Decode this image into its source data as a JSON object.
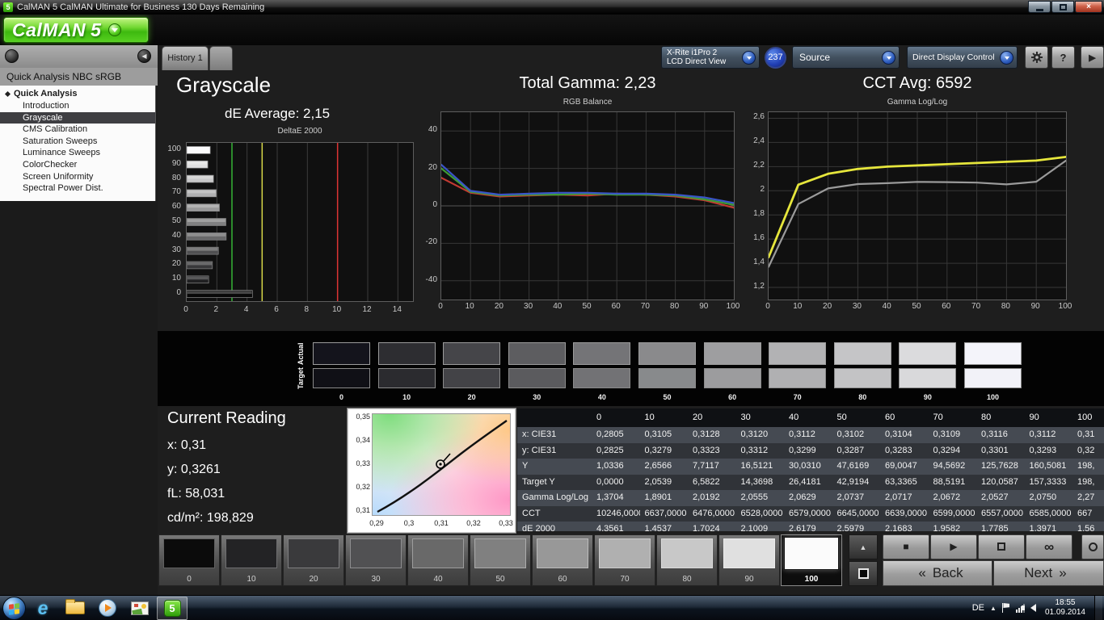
{
  "titlebar": {
    "app_icon": "5",
    "title": "CalMAN 5 CalMAN Ultimate for Business 130 Days Remaining",
    "close_glyph": "×"
  },
  "logo": {
    "brand": "CalMAN",
    "version": "5"
  },
  "toolbar": {
    "history_tab": "History 1",
    "meter": {
      "line1": "X-Rite i1Pro 2",
      "line2": "LCD Direct View"
    },
    "meter_count": "237",
    "source_label": "Source",
    "display_control_label": "Direct Display Control",
    "help_glyph": "?",
    "expand_glyph": "▶"
  },
  "sidebar": {
    "collapse_glyph": "◀",
    "workflow_title": "Quick Analysis NBC sRGB",
    "tree_root": "Quick Analysis",
    "selected_item": "Grayscale",
    "items": [
      "Introduction",
      "Grayscale",
      "CMS Calibration",
      "Saturation Sweeps",
      "Luminance Sweeps",
      "ColorChecker",
      "Screen Uniformity",
      "Spectral Power Dist."
    ]
  },
  "summary": {
    "page_title": "Grayscale",
    "de_average": "dE Average: 2,15",
    "total_gamma": "Total Gamma: 2,23",
    "cct_avg": "CCT Avg: 6592"
  },
  "chart_data": [
    {
      "type": "bar",
      "orientation": "horizontal",
      "title": "DeltaE 2000",
      "categories": [
        0,
        10,
        20,
        30,
        40,
        50,
        60,
        70,
        80,
        90,
        100
      ],
      "values": [
        4.3561,
        1.4537,
        1.7024,
        2.1009,
        2.6179,
        2.5979,
        2.1683,
        1.9582,
        1.7785,
        1.3971,
        1.56
      ],
      "bar_colors": [
        "#080808",
        "#202022",
        "#38383a",
        "#505052",
        "#686869",
        "#808081",
        "#989899",
        "#b0b0b1",
        "#c8c8c9",
        "#e0e0e1",
        "#fafafb"
      ],
      "xlim": [
        0,
        15
      ],
      "x_ticks": [
        0,
        2,
        4,
        6,
        8,
        10,
        12,
        14
      ],
      "reference_lines": [
        {
          "name": "good",
          "value": 3,
          "color": "#35b435"
        },
        {
          "name": "warn",
          "value": 5,
          "color": "#d8d848"
        },
        {
          "name": "fail",
          "value": 10,
          "color": "#dd3333"
        }
      ],
      "grid": true
    },
    {
      "type": "line",
      "title": "RGB Balance",
      "x": [
        0,
        10,
        20,
        30,
        40,
        50,
        60,
        70,
        80,
        90,
        100
      ],
      "x_ticks": [
        0,
        10,
        20,
        30,
        40,
        50,
        60,
        70,
        80,
        90,
        100
      ],
      "ylim": [
        -50,
        50
      ],
      "y_ticks": [
        40,
        20,
        0,
        -20,
        -40
      ],
      "series": [
        {
          "name": "Red",
          "color": "#c23a32",
          "width": 2.2,
          "values": [
            15,
            7,
            5,
            5.5,
            6,
            5.5,
            6.5,
            6,
            5,
            3,
            -1
          ]
        },
        {
          "name": "Green",
          "color": "#3f9c35",
          "width": 2.2,
          "values": [
            20,
            7.5,
            5.5,
            6,
            6,
            6.5,
            6,
            6,
            5.5,
            3.5,
            0.5
          ]
        },
        {
          "name": "Blue",
          "color": "#3a55c8",
          "width": 2.2,
          "values": [
            22,
            8,
            6,
            6.5,
            7,
            7,
            6.5,
            6.5,
            6,
            4.5,
            1.5
          ]
        }
      ],
      "grid": true
    },
    {
      "type": "line",
      "title": "Gamma Log/Log",
      "x": [
        0,
        10,
        20,
        30,
        40,
        50,
        60,
        70,
        80,
        90,
        100
      ],
      "x_ticks": [
        0,
        10,
        20,
        30,
        40,
        50,
        60,
        70,
        80,
        90,
        100
      ],
      "ylim": [
        1.1,
        2.65
      ],
      "y_ticks": [
        2.6,
        2.4,
        2.2,
        2,
        1.8,
        1.6,
        1.4,
        1.2
      ],
      "y_tick_labels": [
        "2,6",
        "2,4",
        "2,2",
        "2",
        "1,8",
        "1,6",
        "1,4",
        "1,2"
      ],
      "series": [
        {
          "name": "Target",
          "color": "#e6e63c",
          "width": 2.8,
          "values": [
            1.45,
            2.05,
            2.14,
            2.18,
            2.2,
            2.21,
            2.22,
            2.23,
            2.24,
            2.25,
            2.28
          ]
        },
        {
          "name": "Measured",
          "color": "#9b9b9b",
          "width": 2.2,
          "values": [
            1.3704,
            1.8901,
            2.0192,
            2.0555,
            2.0629,
            2.0737,
            2.0717,
            2.0672,
            2.0527,
            2.075,
            2.25
          ]
        }
      ],
      "grid": true
    }
  ],
  "swatch_strip": {
    "row_labels": [
      "Actual",
      "Target"
    ],
    "columns": [
      "0",
      "10",
      "20",
      "30",
      "40",
      "50",
      "60",
      "70",
      "80",
      "90",
      "100"
    ],
    "actual_colors": [
      "#14141c",
      "#2d2d31",
      "#454549",
      "#5d5d60",
      "#747477",
      "#8a8a8c",
      "#9e9ea0",
      "#b2b2b4",
      "#c5c5c7",
      "#dbdbdd",
      "#f4f4fa"
    ],
    "target_colors": [
      "#101016",
      "#2b2b2f",
      "#434347",
      "#5b5b5e",
      "#727275",
      "#888a8c",
      "#9c9c9e",
      "#b0b0b2",
      "#c3c3c5",
      "#d9d9db",
      "#f2f2f8"
    ]
  },
  "current_reading": {
    "title": "Current Reading",
    "rows": [
      {
        "label": "x:",
        "value": "0,31"
      },
      {
        "label": "y:",
        "value": "0,3261"
      },
      {
        "label": "fL:",
        "value": "58,031"
      },
      {
        "label": "cd/m²:",
        "value": "198,829"
      }
    ]
  },
  "cie_chart": {
    "y_ticks": [
      "0,35",
      "0,34",
      "0,33",
      "0,32",
      "0,31"
    ],
    "x_ticks": [
      "0,29",
      "0,3",
      "0,31",
      "0,32",
      "0,33"
    ]
  },
  "data_table": {
    "column_headers": [
      "0",
      "10",
      "20",
      "30",
      "40",
      "50",
      "60",
      "70",
      "80",
      "90",
      "100"
    ],
    "rows": [
      {
        "label": "x: CIE31",
        "values": [
          "0,2805",
          "0,3105",
          "0,3128",
          "0,3120",
          "0,3112",
          "0,3102",
          "0,3104",
          "0,3109",
          "0,3116",
          "0,3112",
          "0,31"
        ]
      },
      {
        "label": "y: CIE31",
        "values": [
          "0,2825",
          "0,3279",
          "0,3323",
          "0,3312",
          "0,3299",
          "0,3287",
          "0,3283",
          "0,3294",
          "0,3301",
          "0,3293",
          "0,32"
        ]
      },
      {
        "label": "Y",
        "values": [
          "1,0336",
          "2,6566",
          "7,7117",
          "16,5121",
          "30,0310",
          "47,6169",
          "69,0047",
          "94,5692",
          "125,7628",
          "160,5081",
          "198,"
        ]
      },
      {
        "label": "Target Y",
        "values": [
          "0,0000",
          "2,0539",
          "6,5822",
          "14,3698",
          "26,4181",
          "42,9194",
          "63,3365",
          "88,5191",
          "120,0587",
          "157,3333",
          "198,"
        ]
      },
      {
        "label": "Gamma Log/Log",
        "values": [
          "1,3704",
          "1,8901",
          "2,0192",
          "2,0555",
          "2,0629",
          "2,0737",
          "2,0717",
          "2,0672",
          "2,0527",
          "2,0750",
          "2,27"
        ]
      },
      {
        "label": "CCT",
        "values": [
          "10246,0000",
          "6637,0000",
          "6476,0000",
          "6528,0000",
          "6579,0000",
          "6645,0000",
          "6639,0000",
          "6599,0000",
          "6557,0000",
          "6585,0000",
          "667"
        ]
      },
      {
        "label": "dE 2000",
        "values": [
          "4,3561",
          "1,4537",
          "1,7024",
          "2,1009",
          "2,6179",
          "2,5979",
          "2,1683",
          "1,9582",
          "1,7785",
          "1,3971",
          "1,56"
        ]
      }
    ]
  },
  "patch_strip": {
    "labels": [
      "0",
      "10",
      "20",
      "30",
      "40",
      "50",
      "60",
      "70",
      "80",
      "90",
      "100"
    ],
    "colors": [
      "#0b0b0b",
      "#232325",
      "#3a3a3c",
      "#515153",
      "#696969",
      "#808080",
      "#989898",
      "#b0b0b0",
      "#c8c8c8",
      "#e0e0e0",
      "#fbfbfb"
    ],
    "selected": "100"
  },
  "transport": {
    "patch_up_glyph": "▲",
    "stop_glyph": "■",
    "play_glyph": "▶",
    "loop_glyph": "∞"
  },
  "nav": {
    "back_arrows": "«",
    "back_label": "Back",
    "next_label": "Next",
    "next_arrows": "»"
  },
  "taskbar": {
    "ie_glyph": "e",
    "calman_glyph": "5",
    "language": "DE",
    "tray_expand_glyph": "▲",
    "time": "18:55",
    "date": "01.09.2014"
  }
}
